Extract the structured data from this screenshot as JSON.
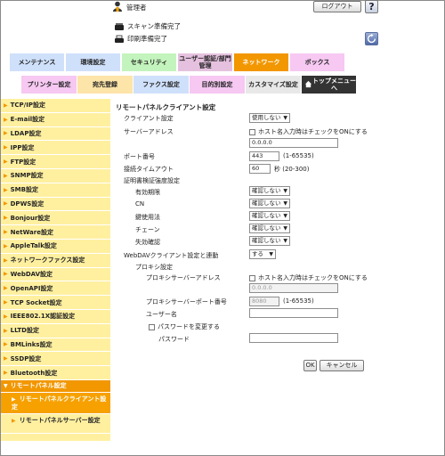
{
  "header": {
    "admin_label": "管理者",
    "logout_label": "ログアウト",
    "help_label": "?",
    "status_scan": "スキャン準備完了",
    "status_print": "印刷準備完了"
  },
  "tabs_main": [
    {
      "label": "メンテナンス",
      "color": "#cfe0fa"
    },
    {
      "label": "環境設定",
      "color": "#cfe0fa"
    },
    {
      "label": "セキュリティ",
      "color": "#c4f4bd"
    },
    {
      "label": "ユーザー認証/部門管理",
      "color": "#e5c1df"
    },
    {
      "label": "ネットワーク",
      "color": "#f29700"
    },
    {
      "label": "ボックス",
      "color": "#f6c8f2"
    }
  ],
  "tabs_sub": [
    {
      "label": "プリンター設定",
      "color": "#f6c8f2"
    },
    {
      "label": "宛先登録",
      "color": "#fde4a8"
    },
    {
      "label": "ファクス設定",
      "color": "#cfe0fa"
    },
    {
      "label": "目的別設定",
      "color": "#f6c8f2"
    },
    {
      "label": "カスタマイズ設定",
      "color": "#e8e8e8"
    },
    {
      "label": "トップメニューへ",
      "color": "#333333"
    }
  ],
  "sidebar": {
    "items": [
      "TCP/IP設定",
      "E-mail設定",
      "LDAP設定",
      "IPP設定",
      "FTP設定",
      "SNMP設定",
      "SMB設定",
      "DPWS設定",
      "Bonjour設定",
      "NetWare設定",
      "AppleTalk設定",
      "ネットワークファクス設定",
      "WebDAV設定",
      "OpenAPI設定",
      "TCP Socket設定",
      "IEEE802.1X認証設定",
      "LLTD設定",
      "BMLinks設定",
      "SSDP設定",
      "Bluetooth設定"
    ],
    "open_item": "リモートパネル設定",
    "sub_items": [
      "リモートパネルクライアント設定",
      "リモートパネルサーバー設定"
    ]
  },
  "form": {
    "title": "リモートパネルクライアント設定",
    "client_label": "クライアント設定",
    "client_value": "使用しない",
    "server_addr_label": "サーバーアドレス",
    "hostname_check": "ホスト名入力時はチェックをONにする",
    "server_addr_value": "0.0.0.0",
    "port_label": "ポート番号",
    "port_value": "443",
    "port_range": "(1-65535)",
    "timeout_label": "接続タイムアウト",
    "timeout_value": "60",
    "timeout_range": "秒 (20-300)",
    "cert_label": "証明書検証強度設定",
    "cert_rows": [
      {
        "label": "有効期限",
        "value": "確認しない"
      },
      {
        "label": "CN",
        "value": "確認しない"
      },
      {
        "label": "鍵使用法",
        "value": "確認しない"
      },
      {
        "label": "チェーン",
        "value": "確認しない"
      },
      {
        "label": "失効確認",
        "value": "確認しない"
      }
    ],
    "webdav_label": "WebDAVクライアント設定と連動",
    "webdav_value": "する",
    "proxy_label": "プロキシ設定",
    "proxy_addr_label": "プロキシサーバーアドレス",
    "proxy_hostname_check": "ホスト名入力時はチェックをONにする",
    "proxy_addr_value": "0.0.0.0",
    "proxy_port_label": "プロキシサーバーポート番号",
    "proxy_port_value": "8080",
    "proxy_port_range": "(1-65535)",
    "user_label": "ユーザー名",
    "user_value": "",
    "change_pw_label": "パスワードを変更する",
    "password_label": "パスワード",
    "password_value": "",
    "ok_label": "OK",
    "cancel_label": "キャンセル"
  }
}
